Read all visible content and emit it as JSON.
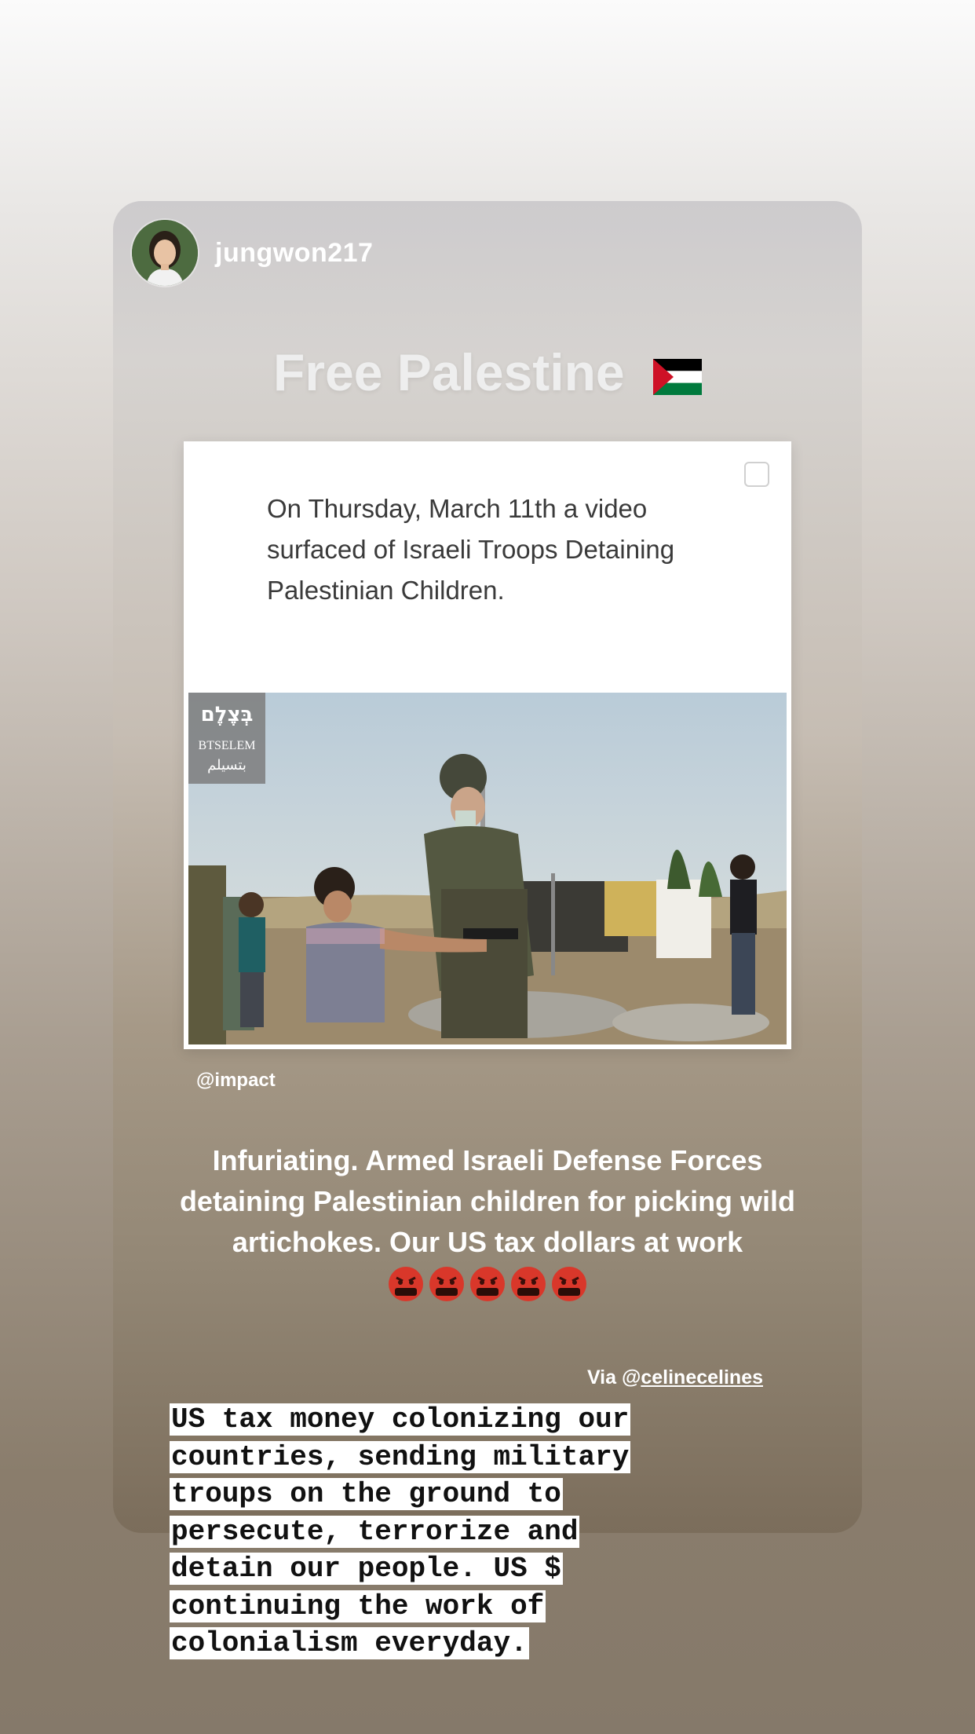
{
  "story": {
    "username": "jungwon217",
    "headline": "Free Palestine",
    "flag_icon": "palestine-flag-icon",
    "post": {
      "text": "On Thursday, March 11th a video surfaced of Israeli Troops Detaining Palestinian Children.",
      "watermark_hebrew": "בְּצֶלֶם",
      "watermark_latin": "BTSELEM",
      "watermark_arabic": "بتسيلم"
    },
    "credit": "@impact",
    "body": "Infuriating. Armed Israeli Defense Forces detaining Palestinian children for picking wild artichokes. Our US tax dollars at work",
    "emoji": [
      "🤬",
      "🤬",
      "🤬",
      "🤬",
      "🤬"
    ],
    "via_prefix": "Via @",
    "via_handle": "celinecelines",
    "caption_lines": [
      "US tax money colonizing our",
      "countries, sending military",
      "troups on the ground to",
      "persecute, terrorize and",
      "detain our people. US $",
      "continuing the work of",
      "colonialism everyday."
    ]
  },
  "colors": {
    "flag_red": "#ce1126",
    "flag_black": "#000000",
    "flag_green": "#007a3d",
    "emoji_red": "#d9372a"
  }
}
